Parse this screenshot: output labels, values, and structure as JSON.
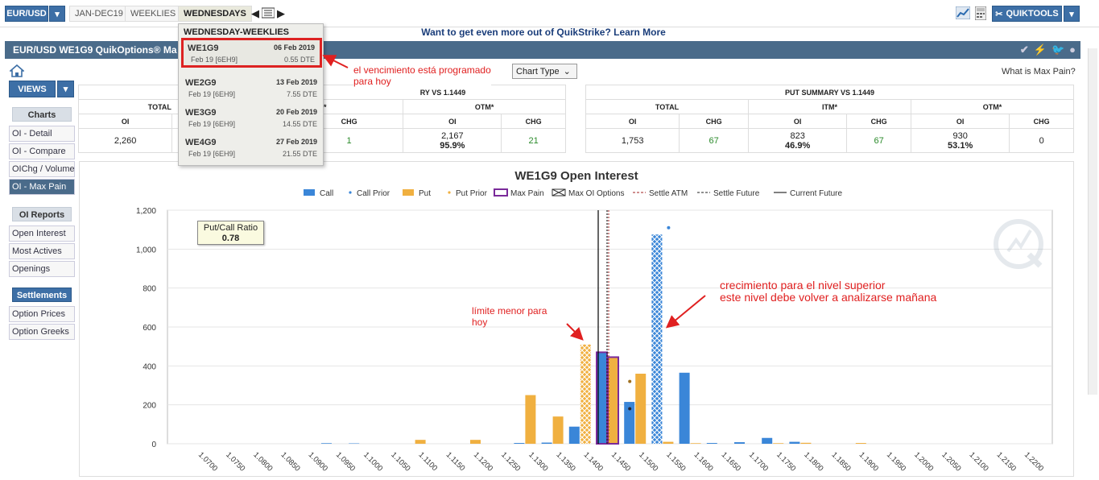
{
  "topbar": {
    "symbol": "EUR/USD",
    "tabs": [
      "JAN-DEC19",
      "WEEKLIES",
      "WEDNESDAYS"
    ],
    "quiktools": "QUIKTOOLS"
  },
  "promo": "Want to get even more out of QuikStrike? Learn More",
  "header": {
    "title": "EUR/USD WE1G9 QuikOptions® Ma"
  },
  "controls": {
    "chart_type": "Chart Type",
    "max_pain_link": "What is Max Pain?"
  },
  "nav": {
    "views": "VIEWS",
    "charts_head": "Charts",
    "charts": [
      "OI - Detail",
      "OI - Compare",
      "OIChg / Volume",
      "OI - Max Pain"
    ],
    "reports_head": "OI Reports",
    "reports": [
      "Open Interest",
      "Most Actives",
      "Openings"
    ],
    "settlements_head": "Settlements",
    "settlements": [
      "Option Prices",
      "Option Greeks"
    ]
  },
  "call_summary": {
    "title_partial": "RY VS 1.1449",
    "total_label": "TOTAL",
    "itm_label": "M*",
    "otm_label": "OTM*",
    "oi_label": "OI",
    "chg_label": "CHG",
    "total_oi": "2,260",
    "itm_chg": "1",
    "otm_oi": "2,167",
    "otm_pct": "95.9%",
    "otm_chg": "21"
  },
  "put_summary": {
    "title": "PUT SUMMARY VS 1.1449",
    "total_label": "TOTAL",
    "itm_label": "ITM*",
    "otm_label": "OTM*",
    "oi_label": "OI",
    "chg_label": "CHG",
    "total_oi": "1,753",
    "total_chg": "67",
    "itm_oi": "823",
    "itm_pct": "46.9%",
    "itm_chg": "67",
    "otm_oi": "930",
    "otm_pct": "53.1%",
    "otm_chg": "0"
  },
  "dropdown": {
    "title": "WEDNESDAY-WEEKLIES",
    "items": [
      {
        "code": "WE1G9",
        "date": "06 Feb 2019",
        "sub": "Feb 19  [6EH9]",
        "dte": "0.55 DTE"
      },
      {
        "code": "WE2G9",
        "date": "13 Feb 2019",
        "sub": "Feb 19  [6EH9]",
        "dte": "7.55 DTE"
      },
      {
        "code": "WE3G9",
        "date": "20 Feb 2019",
        "sub": "Feb 19  [6EH9]",
        "dte": "14.55 DTE"
      },
      {
        "code": "WE4G9",
        "date": "27 Feb 2019",
        "sub": "Feb 19  [6EH9]",
        "dte": "21.55 DTE"
      }
    ]
  },
  "annotations": {
    "a1_line1": "el vencimiento está programado",
    "a1_line2": "para hoy",
    "a2_line1": "límite menor para",
    "a2_line2": "hoy",
    "a3_line1": "crecimiento para el nivel superior",
    "a3_line2": "este nivel debe volver a analizarse mañana"
  },
  "colors": {
    "call": "#3a86d8",
    "put": "#f0b040",
    "max_pain": "#7a2a9a",
    "header": "#4a6b8a",
    "annotation": "#e02020"
  },
  "chart_data": {
    "type": "bar",
    "title": "WE1G9 Open Interest",
    "ratio_label": "Put/Call Ratio",
    "ratio_value": "0.78",
    "legend": [
      "Call",
      "Call Prior",
      "Put",
      "Put Prior",
      "Max Pain",
      "Max OI Options",
      "Settle ATM",
      "Settle Future",
      "Current Future"
    ],
    "categories": [
      "1.0700",
      "1.0750",
      "1.0800",
      "1.0850",
      "1.0900",
      "1.0950",
      "1.1000",
      "1.1050",
      "1.1100",
      "1.1150",
      "1.1200",
      "1.1250",
      "1.1300",
      "1.1350",
      "1.1400",
      "1.1450",
      "1.1500",
      "1.1550",
      "1.1600",
      "1.1650",
      "1.1700",
      "1.1750",
      "1.1800",
      "1.1850",
      "1.1900",
      "1.1950",
      "1.2000",
      "1.2050",
      "1.2100",
      "1.2150",
      "1.2200"
    ],
    "series": [
      {
        "name": "Call",
        "values": [
          0,
          0,
          0,
          0,
          0,
          3,
          2,
          0,
          0,
          0,
          0,
          0,
          4,
          6,
          88,
          470,
          215,
          1075,
          365,
          4,
          8,
          30,
          10,
          0,
          0,
          0,
          0,
          0,
          0,
          0,
          0
        ]
      },
      {
        "name": "Put",
        "values": [
          0,
          0,
          0,
          0,
          0,
          0,
          0,
          0,
          20,
          0,
          20,
          0,
          250,
          140,
          510,
          445,
          360,
          10,
          3,
          0,
          0,
          3,
          5,
          0,
          4,
          0,
          0,
          0,
          0,
          0,
          0
        ]
      }
    ],
    "ylim": [
      0,
      1200
    ],
    "yticks": [
      0,
      200,
      400,
      600,
      800,
      1000,
      1200
    ],
    "ytick_labels": [
      "0",
      "200",
      "400",
      "600",
      "800",
      "1,000",
      "1,200"
    ]
  }
}
